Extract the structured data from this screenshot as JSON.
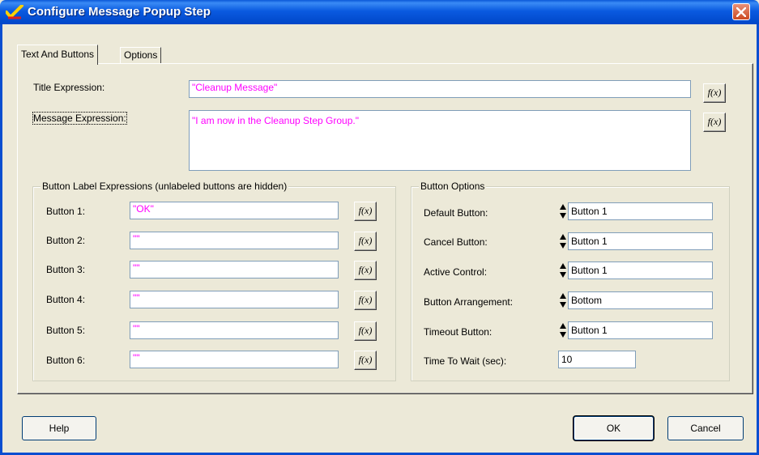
{
  "window": {
    "title": "Configure Message Popup Step"
  },
  "tabs": [
    {
      "label": "Text And Buttons"
    },
    {
      "label": "Options"
    }
  ],
  "title_expression": {
    "label": "Title Expression:",
    "value": "\"Cleanup Message\"",
    "fx": "f(x)"
  },
  "message_expression": {
    "label": "Message Expression:",
    "value": "\"I am now in the Cleanup Step Group.\"",
    "fx": "f(x)"
  },
  "button_labels": {
    "legend": "Button Label Expressions (unlabeled buttons are hidden)",
    "fx": "f(x)",
    "items": [
      {
        "label": "Button 1:",
        "value": "\"OK\""
      },
      {
        "label": "Button 2:",
        "value": "\"\""
      },
      {
        "label": "Button 3:",
        "value": "\"\""
      },
      {
        "label": "Button 4:",
        "value": "\"\""
      },
      {
        "label": "Button 5:",
        "value": "\"\""
      },
      {
        "label": "Button 6:",
        "value": "\"\""
      }
    ]
  },
  "button_options": {
    "legend": "Button Options",
    "default_button": {
      "label": "Default Button:",
      "value": "Button 1"
    },
    "cancel_button": {
      "label": "Cancel Button:",
      "value": "Button 1"
    },
    "active_control": {
      "label": "Active Control:",
      "value": "Button 1"
    },
    "button_arrangement": {
      "label": "Button Arrangement:",
      "value": "Bottom"
    },
    "timeout_button": {
      "label": "Timeout Button:",
      "value": "Button 1"
    },
    "time_to_wait": {
      "label": "Time To Wait (sec):",
      "value": "10"
    }
  },
  "footer": {
    "help": "Help",
    "ok": "OK",
    "cancel": "Cancel"
  },
  "colors": {
    "expression_text": "#ff00ff",
    "titlebar": "#0a5ae0"
  }
}
